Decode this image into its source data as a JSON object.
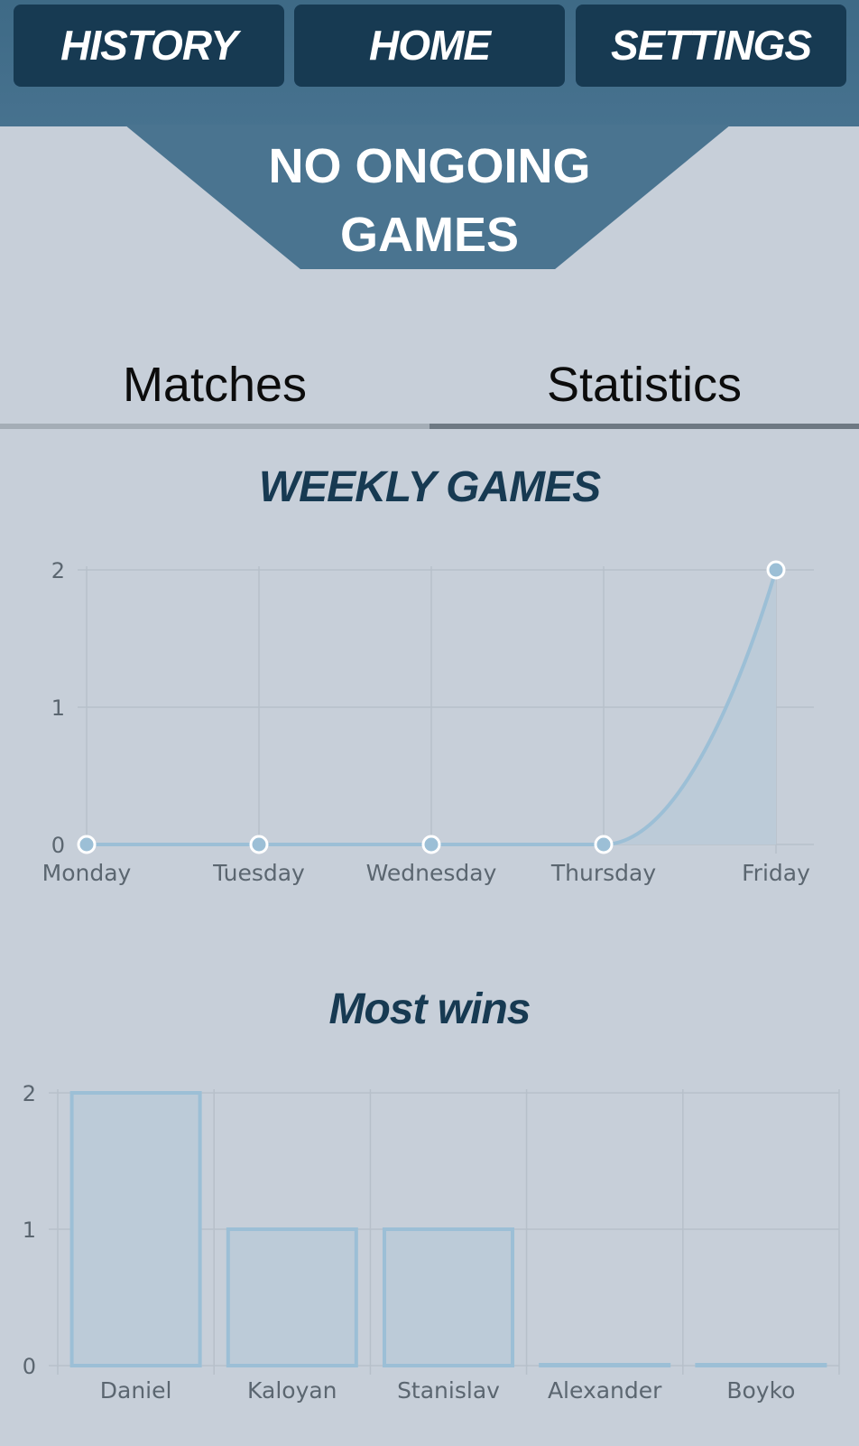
{
  "nav": {
    "history": "HISTORY",
    "home": "HOME",
    "settings": "SETTINGS"
  },
  "banner": {
    "text": "NO ONGOING\nGAMES"
  },
  "tabs": {
    "matches": "Matches",
    "statistics": "Statistics",
    "active": "statistics"
  },
  "colors": {
    "header": "#3e6a86",
    "button": "#173a52",
    "background": "#c7cfd9",
    "series": "#9cbfd6",
    "fill": "#bccbd8"
  },
  "chart_data": [
    {
      "type": "line",
      "title": "WEEKLY GAMES",
      "categories": [
        "Monday",
        "Tuesday",
        "Wednesday",
        "Thursday",
        "Friday"
      ],
      "values": [
        0,
        0,
        0,
        0,
        2
      ],
      "yticks": [
        0,
        1,
        2
      ],
      "ylim": [
        0,
        2
      ],
      "grid": true,
      "filled": true
    },
    {
      "type": "bar",
      "title": "Most wins",
      "categories": [
        "Daniel",
        "Kaloyan",
        "Stanislav",
        "Alexander",
        "Boyko"
      ],
      "values": [
        2,
        1,
        1,
        0,
        0
      ],
      "yticks": [
        0,
        1,
        2
      ],
      "ylim": [
        0,
        2
      ],
      "grid": true
    }
  ]
}
